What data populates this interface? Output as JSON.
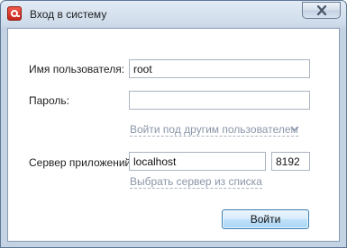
{
  "window": {
    "title": "Вход в систему",
    "icon": "app-logo-icon",
    "close_icon": "close-icon"
  },
  "form": {
    "username_label": "Имя пользователя:",
    "username_value": "root",
    "password_label": "Пароль:",
    "password_value": "",
    "other_user_link": "Войти под другим пользователем",
    "other_user_chevron": "chevron-down-icon",
    "server_label": "Сервер приложений:",
    "server_host_value": "localhost",
    "server_port_value": "8192",
    "choose_server_link": "Выбрать сервер из списка",
    "login_button": "Войти"
  },
  "colors": {
    "accent": "#c8251a",
    "link": "#8a96a8"
  }
}
